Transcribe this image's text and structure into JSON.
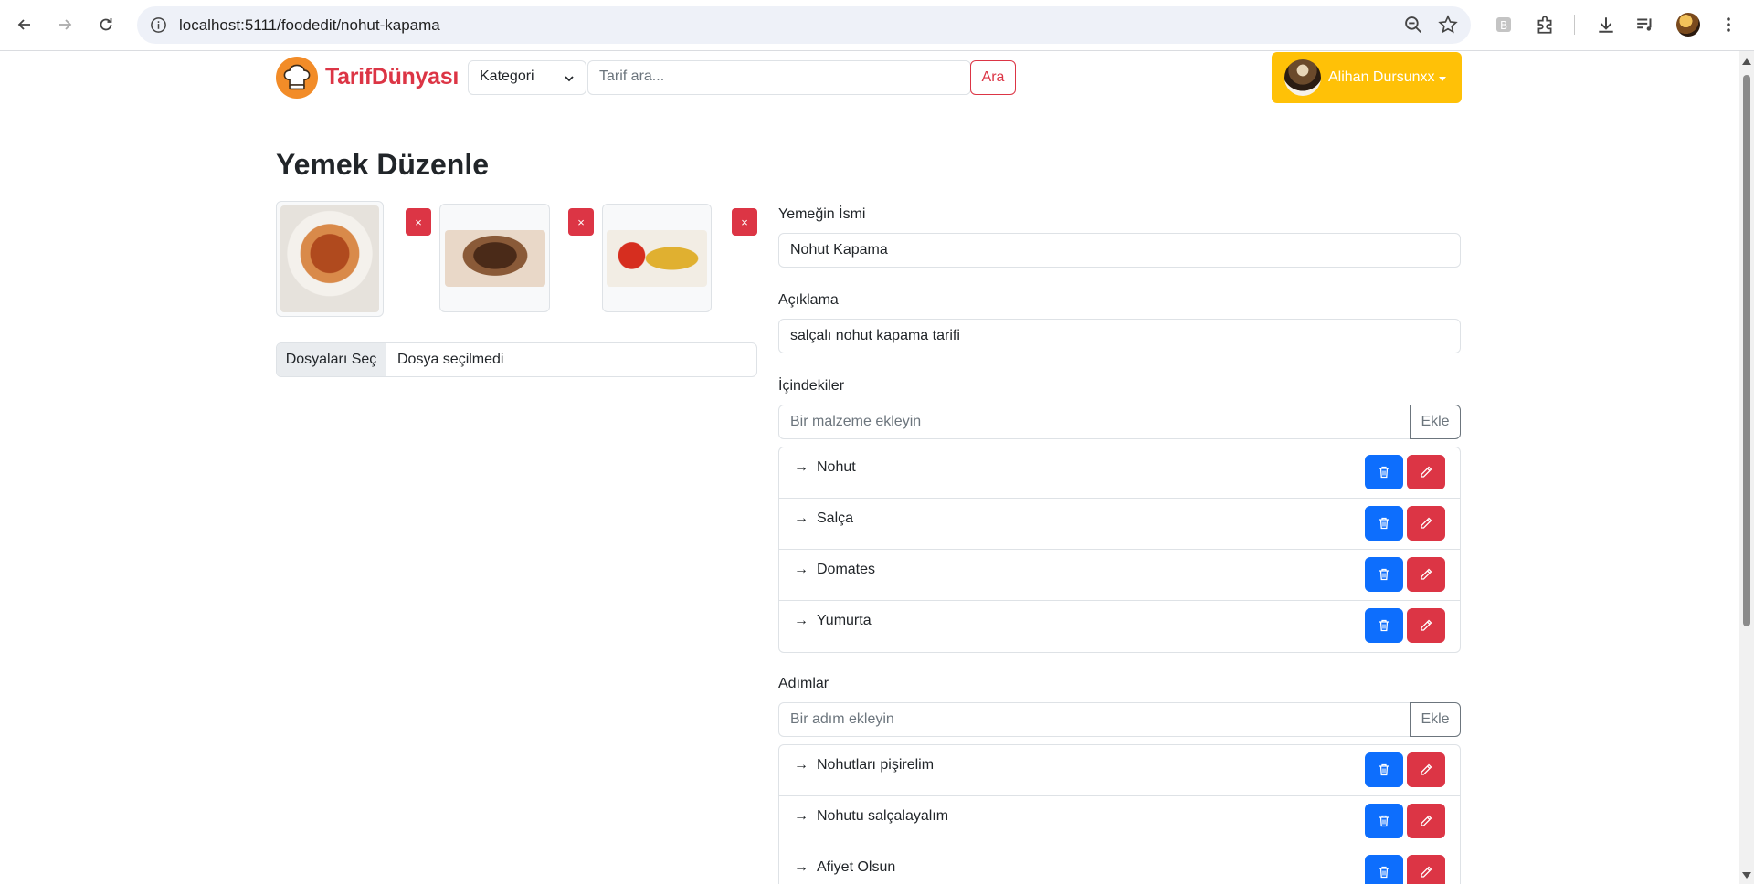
{
  "browser": {
    "url": "localhost:5111/foodedit/nohut-kapama"
  },
  "navbar": {
    "brand": "TarifDünyası",
    "category_select": "Kategori",
    "search_placeholder": "Tarif ara...",
    "search_button": "Ara",
    "user_name": "Alihan Dursunxx"
  },
  "page": {
    "title": "Yemek Düzenle",
    "delete_symbol": "×",
    "file_button": "Dosyaları Seç",
    "file_status": "Dosya seçilmedi"
  },
  "form": {
    "name_label": "Yemeğin İsmi",
    "name_value": "Nohut Kapama",
    "desc_label": "Açıklama",
    "desc_value": "salçalı nohut kapama tarifi",
    "ingredients_label": "İçindekiler",
    "ingredients_placeholder": "Bir malzeme ekleyin",
    "add_label": "Ekle",
    "ingredients": [
      "Nohut",
      "Salça",
      "Domates",
      "Yumurta"
    ],
    "steps_label": "Adımlar",
    "steps_placeholder": "Bir adım ekleyin",
    "steps": [
      "Nohutları pişirelim",
      "Nohutu salçalayalım",
      "Afiyet Olsun"
    ],
    "arrow": "→"
  },
  "colors": {
    "brand_red": "#dc3545",
    "primary_blue": "#0d6efd",
    "warning_yellow": "#ffc107",
    "logo_orange": "#f28c28"
  }
}
